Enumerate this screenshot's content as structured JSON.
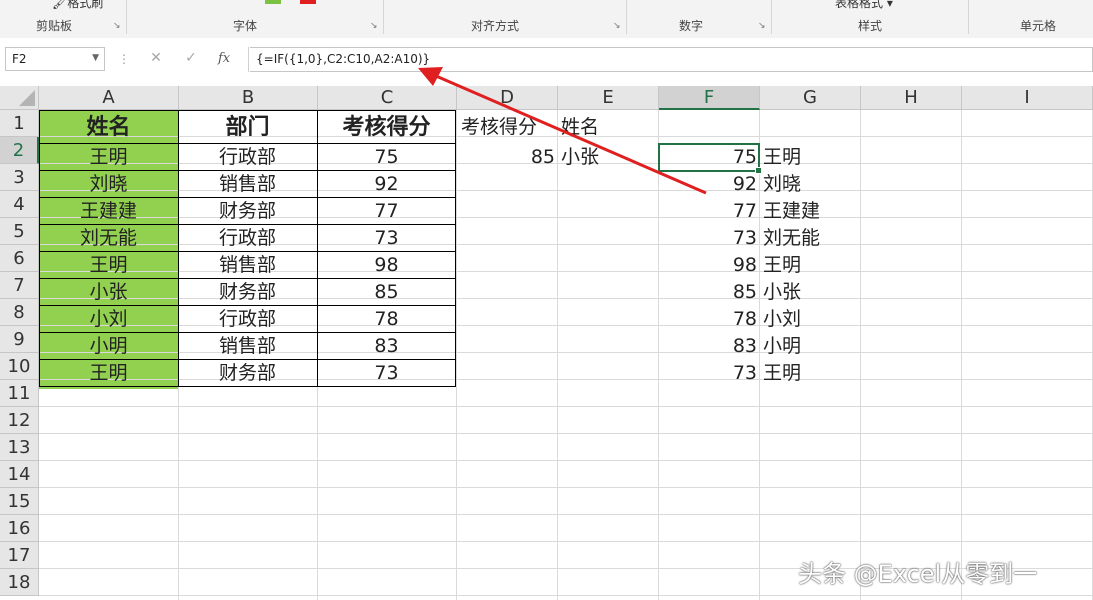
{
  "ribbon": {
    "groups": [
      "剪贴板",
      "字体",
      "对齐方式",
      "数字",
      "样式",
      "单元格"
    ],
    "format_painter": "格式刷",
    "table_format": "表格格式 ▾"
  },
  "formula_bar": {
    "name_box": "F2",
    "cancel_icon": "✕",
    "enter_icon": "✓",
    "fx": "fx",
    "formula": "{=IF({1,0},C2:C10,A2:A10)}"
  },
  "columns": [
    "A",
    "B",
    "C",
    "D",
    "E",
    "F",
    "G",
    "H",
    "I"
  ],
  "rows": [
    "1",
    "2",
    "3",
    "4",
    "5",
    "6",
    "7",
    "8",
    "9",
    "10",
    "11",
    "12",
    "13",
    "14",
    "15",
    "16",
    "17",
    "18"
  ],
  "table": {
    "headers": [
      "姓名",
      "部门",
      "考核得分"
    ],
    "rows": [
      [
        "王明",
        "行政部",
        "75"
      ],
      [
        "刘晓",
        "销售部",
        "92"
      ],
      [
        "王建建",
        "财务部",
        "77"
      ],
      [
        "刘无能",
        "行政部",
        "73"
      ],
      [
        "王明",
        "销售部",
        "98"
      ],
      [
        "小张",
        "财务部",
        "85"
      ],
      [
        "小刘",
        "行政部",
        "78"
      ],
      [
        "小明",
        "销售部",
        "83"
      ],
      [
        "王明",
        "财务部",
        "73"
      ]
    ]
  },
  "lookup": {
    "d1": "考核得分",
    "e1": "姓名",
    "d2": "85",
    "e2": "小张"
  },
  "result": [
    [
      "75",
      "王明"
    ],
    [
      "92",
      "刘晓"
    ],
    [
      "77",
      "王建建"
    ],
    [
      "73",
      "刘无能"
    ],
    [
      "98",
      "王明"
    ],
    [
      "85",
      "小张"
    ],
    [
      "78",
      "小刘"
    ],
    [
      "83",
      "小明"
    ],
    [
      "73",
      "王明"
    ]
  ],
  "watermark": "头条 @Excel从零到一",
  "colors": {
    "accent": "#217346",
    "name_fill": "#92d050",
    "arrow": "#e02020"
  }
}
